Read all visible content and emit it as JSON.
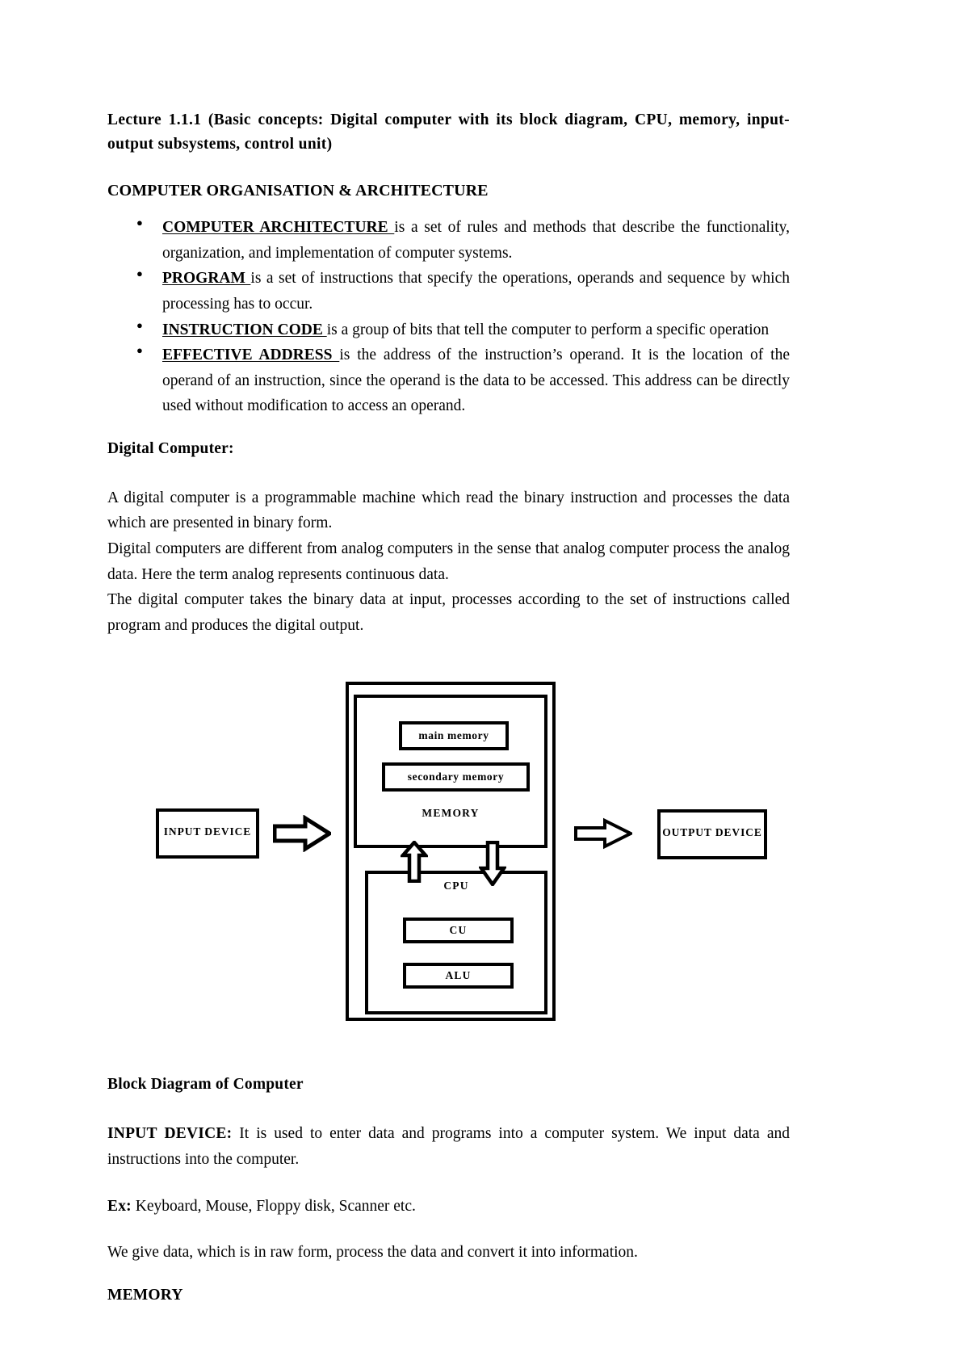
{
  "document": {
    "title_line1": "Lecture 1.1.1 (Basic concepts: Digital computer with its block diagram, CPU, memory,",
    "title_line2": "input-output subsystems, control unit)",
    "section_heading": "COMPUTER ORGANISATION & ARCHITECTURE",
    "bullets": [
      {
        "term": "COMPUTER  ARCHITECTURE ",
        "text": "is a set of rules and methods that describe the functionality, organization, and implementation of computer systems."
      },
      {
        "term": "PROGRAM ",
        "text": "is a set of instructions that specify the operations, operands and sequence by which processing has to occur."
      },
      {
        "term": "INSTRUCTION  CODE ",
        "text": "is a group of bits that tell the computer to perform a specific operation"
      },
      {
        "term": "EFFECTIVE ADDRESS ",
        "text": "is the address of the instruction’s operand. It is the location of the operand of an instruction, since the operand is the data to be accessed. This address can be directly used without modification to access an operand."
      }
    ],
    "digital_computer_heading": "Digital Computer:",
    "paragraphs": [
      "A digital computer is a programmable machine which read the binary instruction and processes the data which are presented in binary form.",
      "Digital computers are different from analog computers in the sense that analog computer process the analog data. Here the term analog represents continuous data.",
      "The digital computer takes the binary data at input, processes according to the set of instructions called program and produces the digital output."
    ],
    "diagram_caption": "Block Diagram of Computer",
    "input_device_heading": "INPUT DEVICE:",
    "input_device_text": " It is used to enter data and programs into a computer system. We input data and instructions into the computer.",
    "ex_label": "Ex:",
    "ex_text": " Keyboard, Mouse, Floppy disk, Scanner etc.",
    "raw_form_paragraph": "We give data, which is in raw form, process the data and convert it into information.",
    "memory_heading": "MEMORY"
  },
  "diagram": {
    "main_memory": "main memory",
    "secondary_memory": "secondary memory",
    "memory": "MEMORY",
    "cpu": "CPU",
    "cu": "CU",
    "alu": "ALU",
    "input_device": "INPUT DEVICE",
    "output_device": "OUTPUT DEVICE",
    "colors": {
      "stroke": "#000000",
      "background": "#ffffff"
    }
  }
}
